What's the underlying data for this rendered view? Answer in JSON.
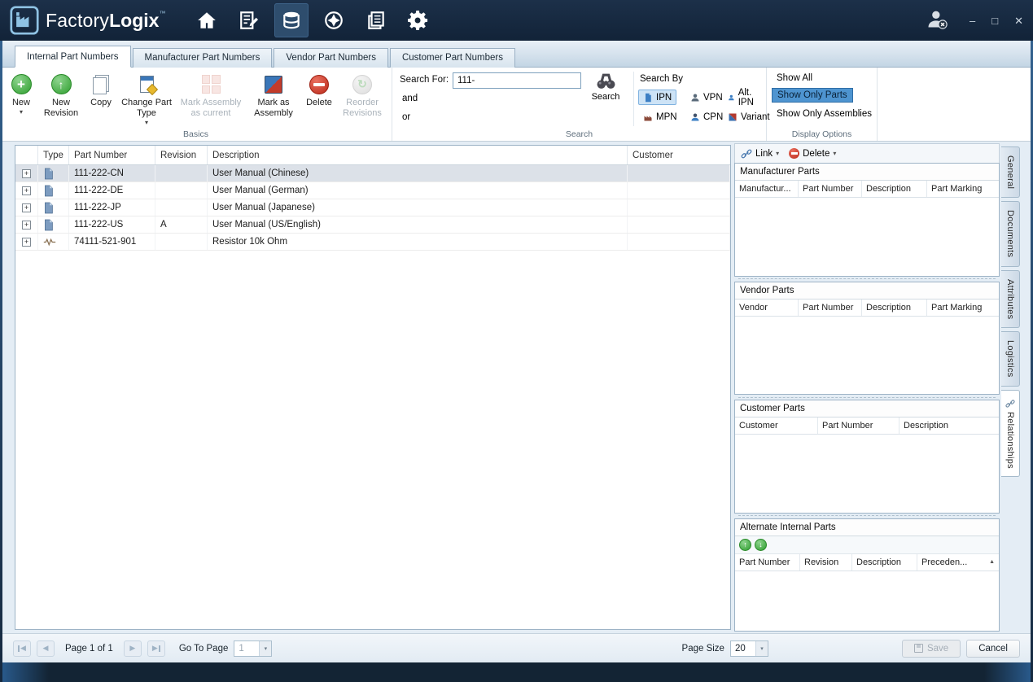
{
  "colors": {
    "titlebar_bg": "#16293f",
    "accent_blue": "#3d85c8",
    "logo_blue": "#8fc3e4",
    "chip_active_bg": "#cde3f6",
    "chip_active_border": "#7fb2e0",
    "selected_option_bg": "#4e94d0",
    "selected_row_bg": "#dce1e8",
    "new_green": "#2e9e2e",
    "delete_red": "#bb2a1a"
  },
  "icons": {
    "plus": "+",
    "up_arrow": "↑",
    "down_arrow": "↓",
    "caret_down": "▾",
    "sort_asc": "▲",
    "refresh": "↻",
    "prev": "◀",
    "next": "▶"
  },
  "titlebar": {
    "brand_factory": "Factory",
    "brand_logix": "Logix",
    "brand_tm": "™",
    "minimize": "–",
    "maximize": "□",
    "close": "✕"
  },
  "tabs": [
    {
      "label": "Internal Part Numbers"
    },
    {
      "label": "Manufacturer Part Numbers"
    },
    {
      "label": "Vendor Part Numbers"
    },
    {
      "label": "Customer Part Numbers"
    }
  ],
  "ribbon": {
    "basics": {
      "group_label": "Basics",
      "new": "New",
      "new_revision": "New Revision",
      "copy": "Copy",
      "change_part_type": "Change Part Type",
      "mark_assembly_as_current": "Mark Assembly as current",
      "mark_as_assembly": "Mark as Assembly",
      "delete": "Delete",
      "reorder_revisions": "Reorder Revisions"
    },
    "search": {
      "group_label": "Search",
      "search_for_label": "Search For:",
      "search_value": "111-",
      "and_label": "and",
      "or_label": "or",
      "search_button": "Search",
      "search_by_label": "Search By",
      "filters": [
        {
          "label": "IPN"
        },
        {
          "label": "VPN"
        },
        {
          "label": "Alt. IPN"
        },
        {
          "label": "MPN"
        },
        {
          "label": "CPN"
        },
        {
          "label": "Variant"
        }
      ]
    },
    "display": {
      "group_label": "Display Options",
      "show_all": "Show All",
      "show_only_parts": "Show Only Parts",
      "show_only_assemblies": "Show Only Assemblies"
    }
  },
  "table": {
    "columns": {
      "type": "Type",
      "part_number": "Part Number",
      "revision": "Revision",
      "description": "Description",
      "customer": "Customer"
    },
    "rows": [
      {
        "part_number": "111-222-CN",
        "revision": "",
        "description": "User Manual (Chinese)",
        "customer": ""
      },
      {
        "part_number": "111-222-DE",
        "revision": "",
        "description": "User Manual (German)",
        "customer": ""
      },
      {
        "part_number": "111-222-JP",
        "revision": "",
        "description": "User Manual (Japanese)",
        "customer": ""
      },
      {
        "part_number": "111-222-US",
        "revision": "A",
        "description": "User Manual (US/English)",
        "customer": ""
      },
      {
        "part_number": "74111-521-901",
        "revision": "",
        "description": "Resistor 10k Ohm",
        "customer": ""
      }
    ]
  },
  "relationships": {
    "link_button": "Link",
    "delete_button": "Delete",
    "manufacturer": {
      "title": "Manufacturer Parts",
      "columns": [
        "Manufactur...",
        "Part Number",
        "Description",
        "Part Marking"
      ]
    },
    "vendor": {
      "title": "Vendor Parts",
      "columns": [
        "Vendor",
        "Part Number",
        "Description",
        "Part Marking"
      ]
    },
    "customer": {
      "title": "Customer Parts",
      "columns": [
        "Customer",
        "Part Number",
        "Description"
      ]
    },
    "alternate": {
      "title": "Alternate Internal Parts",
      "columns": [
        "Part Number",
        "Revision",
        "Description",
        "Preceden..."
      ]
    }
  },
  "side_tabs": [
    {
      "label": "General"
    },
    {
      "label": "Documents"
    },
    {
      "label": "Attributes"
    },
    {
      "label": "Logistics"
    },
    {
      "label": "Relationships"
    }
  ],
  "footer": {
    "page_label": "Page 1 of 1",
    "goto_label": "Go To Page",
    "goto_value": "1",
    "page_size_label": "Page Size",
    "page_size_value": "20",
    "save": "Save",
    "cancel": "Cancel"
  }
}
